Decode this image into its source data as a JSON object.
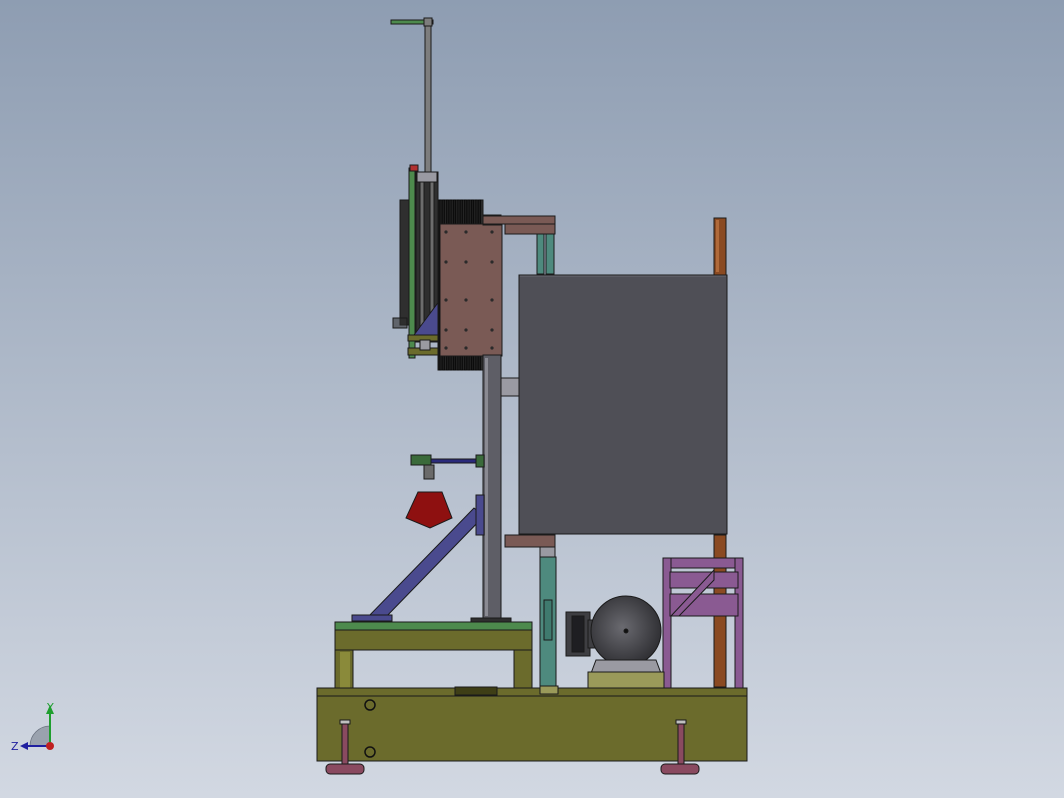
{
  "viewport": {
    "background_top": "#8e9db2",
    "background_bottom": "#d2d8e2"
  },
  "colors": {
    "frame": "#6b6b2c",
    "frame_dark": "#3e3e16",
    "panel": "#4f4f56",
    "rail": "#2f2f2f",
    "plate_brown": "#7a5a55",
    "column": "#5e5e66",
    "strut_blue": "#4a4a8e",
    "cone_red": "#8e1010",
    "post_copper": "#8a4a22",
    "cage_purple": "#8a5a92",
    "teal": "#4e8a7e",
    "motor": "#3e3e42",
    "foot": "#8a4a60",
    "rod": "#7d7d7d",
    "green_top": "#4d8a4d"
  },
  "triad": {
    "x_axis_label": "",
    "y_axis_label": "Y",
    "z_axis_label": "Z",
    "y_color": "#1e9e2e",
    "z_color": "#2020a0",
    "origin_color": "#c02020"
  }
}
